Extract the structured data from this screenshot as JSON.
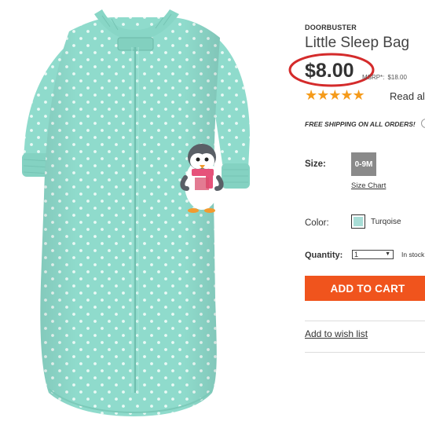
{
  "product": {
    "tag": "DOORBUSTER",
    "title": "Little Sleep Bag",
    "price": "$8.00",
    "msrp_label": "MSRP*:",
    "msrp_value": "$18.00",
    "rating_stars": "★★★★★",
    "rating_value": 5,
    "reviews_link": "Read all"
  },
  "shipping": {
    "text": "FREE SHIPPING ON ALL ORDERS!",
    "icon": "info-icon"
  },
  "size": {
    "label": "Size:",
    "selected": "0-9M",
    "chart_link": "Size Chart"
  },
  "color": {
    "label": "Color:",
    "name": "Turqoise",
    "swatch": "#a8ddd6"
  },
  "quantity": {
    "label": "Quantity:",
    "value": "1",
    "stock": "In stock"
  },
  "cart": {
    "button": "ADD TO CART",
    "accent": "#f0541d"
  },
  "wishlist": {
    "link": "Add to wish list"
  },
  "image": {
    "subject": "sleep-bag-image",
    "fabric_color": "#8fdbcc",
    "dot_color": "#e8f8f4",
    "annotation_color": "#d42b2b"
  }
}
